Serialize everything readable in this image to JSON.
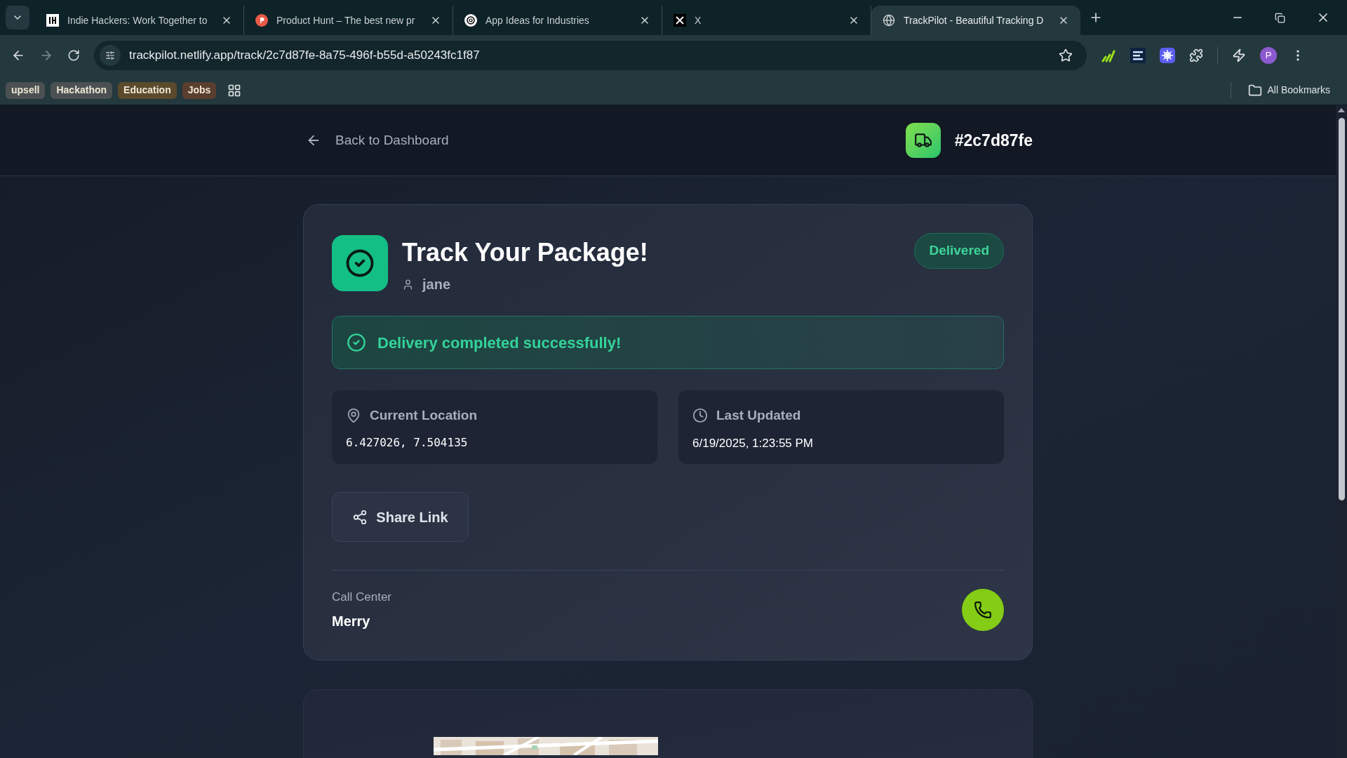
{
  "browser": {
    "tabs": [
      {
        "title": "Indie Hackers: Work Together to",
        "kind": "squarelogo",
        "selected": false
      },
      {
        "title": "Product Hunt – The best new pr",
        "kind": "redcircle",
        "selected": false
      },
      {
        "title": "App Ideas for Industries",
        "kind": "knot",
        "selected": false
      },
      {
        "title": "X",
        "kind": "xlogo",
        "selected": false
      },
      {
        "title": "TrackPilot - Beautiful Tracking D",
        "kind": "globe",
        "selected": true
      }
    ],
    "url": "trackpilot.netlify.app/track/2c7d87fe-8a75-496f-b55d-a50243fc1f87",
    "profile_initial": "P",
    "bookmarks": [
      {
        "label": "upsell",
        "color": "#4b5052"
      },
      {
        "label": "Hackathon",
        "color": "#4b5052"
      },
      {
        "label": "Education",
        "color": "#5b4a2c"
      },
      {
        "label": "Jobs",
        "color": "#5a3e2e"
      }
    ],
    "all_bookmarks": "All Bookmarks"
  },
  "header": {
    "back_link": "Back to Dashboard",
    "tracking_id": "#2c7d87fe"
  },
  "card": {
    "title": "Track Your Package!",
    "user": "jane",
    "status": "Delivered",
    "alert": "Delivery completed successfully!",
    "info": [
      {
        "kind": "location",
        "label": "Current Location",
        "value": "6.427026, 7.504135"
      },
      {
        "kind": "time",
        "label": "Last Updated",
        "value": "6/19/2025, 1:23:55 PM"
      }
    ],
    "share_button": "Share Link",
    "call_center_label": "Call Center",
    "call_center_name": "Merry"
  }
}
